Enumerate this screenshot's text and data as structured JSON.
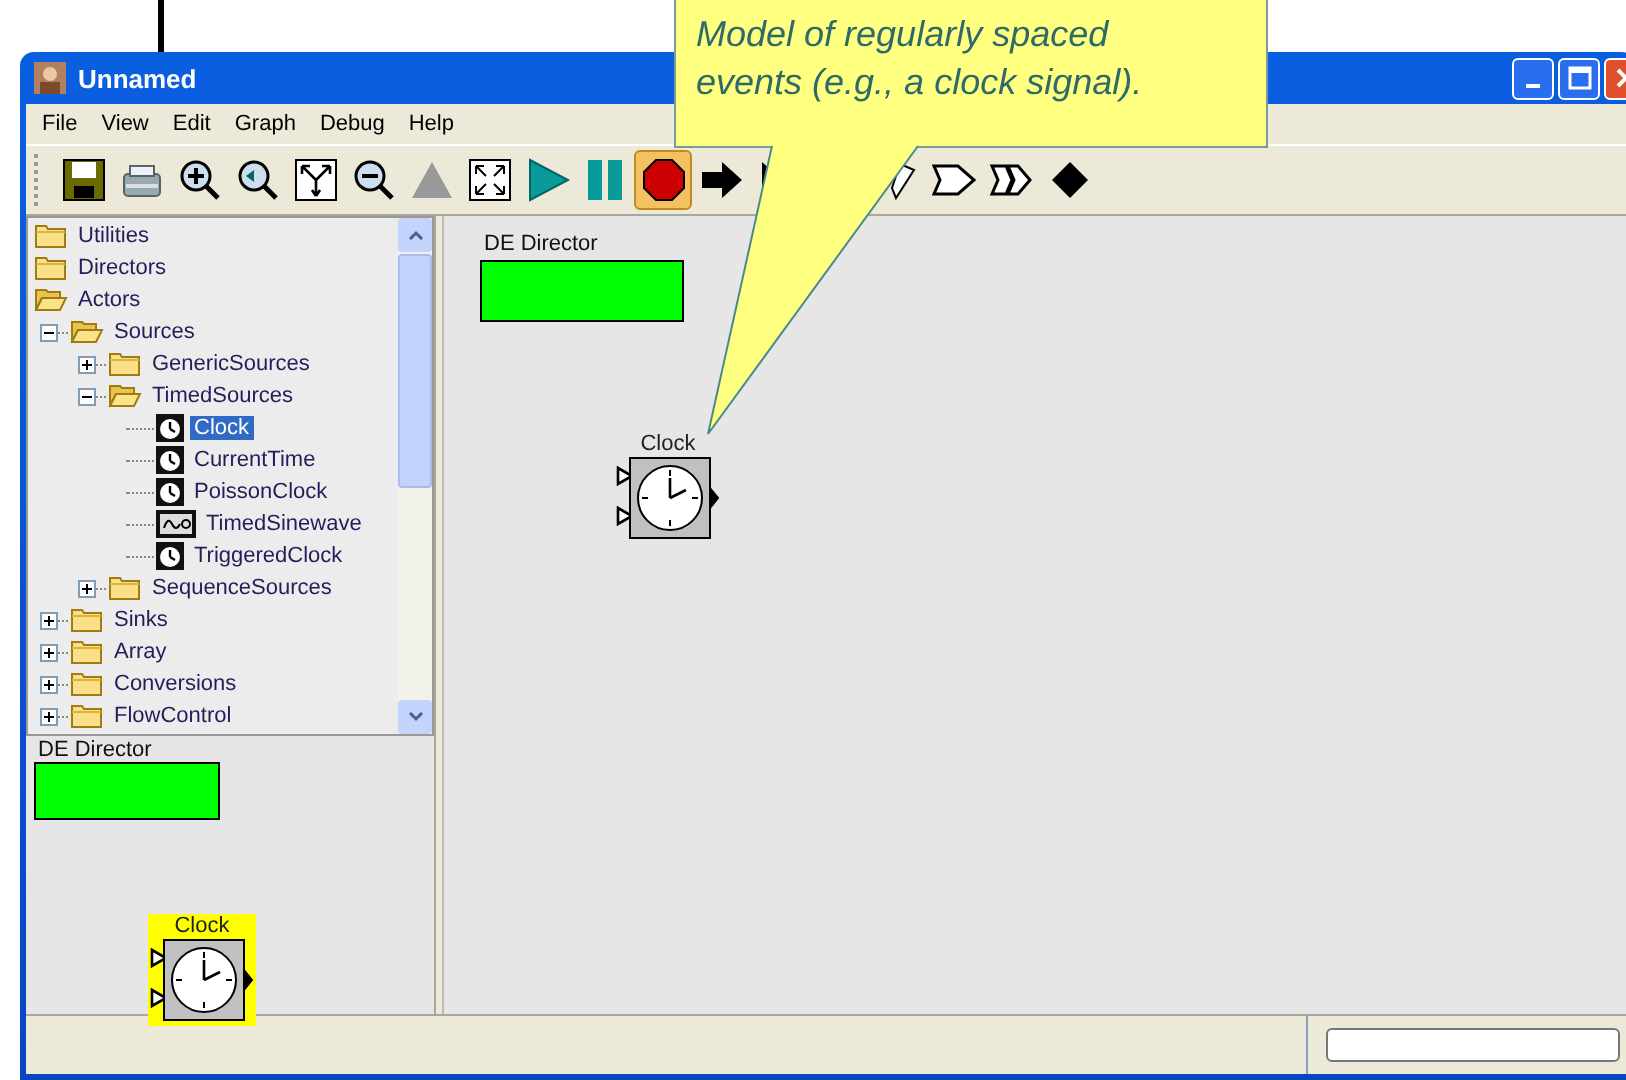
{
  "window": {
    "title": "Unnamed"
  },
  "menu": [
    "File",
    "View",
    "Edit",
    "Graph",
    "Debug",
    "Help"
  ],
  "toolbar": [
    {
      "kind": "save",
      "selected": false
    },
    {
      "kind": "print",
      "selected": false
    },
    {
      "kind": "zoom-in",
      "selected": false
    },
    {
      "kind": "zoom-reset",
      "selected": false
    },
    {
      "kind": "zoom-fit",
      "selected": false
    },
    {
      "kind": "zoom-out",
      "selected": false
    },
    {
      "kind": "up",
      "selected": false
    },
    {
      "kind": "fullscreen",
      "selected": false
    },
    {
      "kind": "run",
      "selected": false
    },
    {
      "kind": "pause",
      "selected": false
    },
    {
      "kind": "stop",
      "selected": true
    },
    {
      "kind": "arrow",
      "selected": false
    },
    {
      "kind": "step",
      "selected": false
    },
    {
      "kind": "partial",
      "selected": false
    },
    {
      "kind": "port",
      "selected": false
    },
    {
      "kind": "multiport",
      "selected": false
    },
    {
      "kind": "relation",
      "selected": false
    }
  ],
  "tooltip": {
    "text": "Model of regularly spaced events (e.g., a clock signal)."
  },
  "library_tree": [
    {
      "label": "Utilities",
      "kind": "folder",
      "expanded": false,
      "selected": false
    },
    {
      "label": "Directors",
      "kind": "folder",
      "expanded": false,
      "selected": false
    },
    {
      "label": "Actors",
      "kind": "folder",
      "expanded": true,
      "selected": false,
      "children": [
        {
          "label": "Sources",
          "kind": "folder",
          "expanded": true,
          "selected": false,
          "children": [
            {
              "label": "GenericSources",
              "kind": "folder",
              "expanded": false,
              "selected": false
            },
            {
              "label": "TimedSources",
              "kind": "folder",
              "expanded": true,
              "selected": false,
              "children": [
                {
                  "label": "Clock",
                  "kind": "clock",
                  "selected": true
                },
                {
                  "label": "CurrentTime",
                  "kind": "clock",
                  "selected": false
                },
                {
                  "label": "PoissonClock",
                  "kind": "clock",
                  "selected": false
                },
                {
                  "label": "TimedSinewave",
                  "kind": "sine",
                  "selected": false
                },
                {
                  "label": "TriggeredClock",
                  "kind": "clock",
                  "selected": false
                }
              ]
            },
            {
              "label": "SequenceSources",
              "kind": "folder",
              "expanded": false,
              "selected": false
            }
          ]
        },
        {
          "label": "Sinks",
          "kind": "folder",
          "expanded": false,
          "selected": false
        },
        {
          "label": "Array",
          "kind": "folder",
          "expanded": false,
          "selected": false
        },
        {
          "label": "Conversions",
          "kind": "folder",
          "expanded": false,
          "selected": false
        },
        {
          "label": "FlowControl",
          "kind": "folder",
          "expanded": false,
          "selected": false
        }
      ]
    }
  ],
  "preview": {
    "director": {
      "label": "DE Director"
    },
    "actor": {
      "label": "Clock",
      "selected": true
    }
  },
  "canvas": {
    "director": {
      "label": "DE Director"
    },
    "actor": {
      "label": "Clock",
      "selected": false
    }
  }
}
